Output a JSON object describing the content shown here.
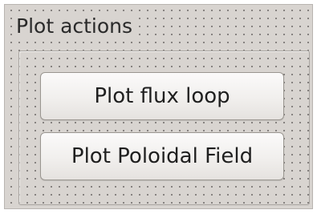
{
  "group": {
    "title": "Plot actions"
  },
  "buttons": {
    "plot_flux_loop": "Plot flux loop",
    "plot_poloidal_field": "Plot Poloidal Field"
  }
}
